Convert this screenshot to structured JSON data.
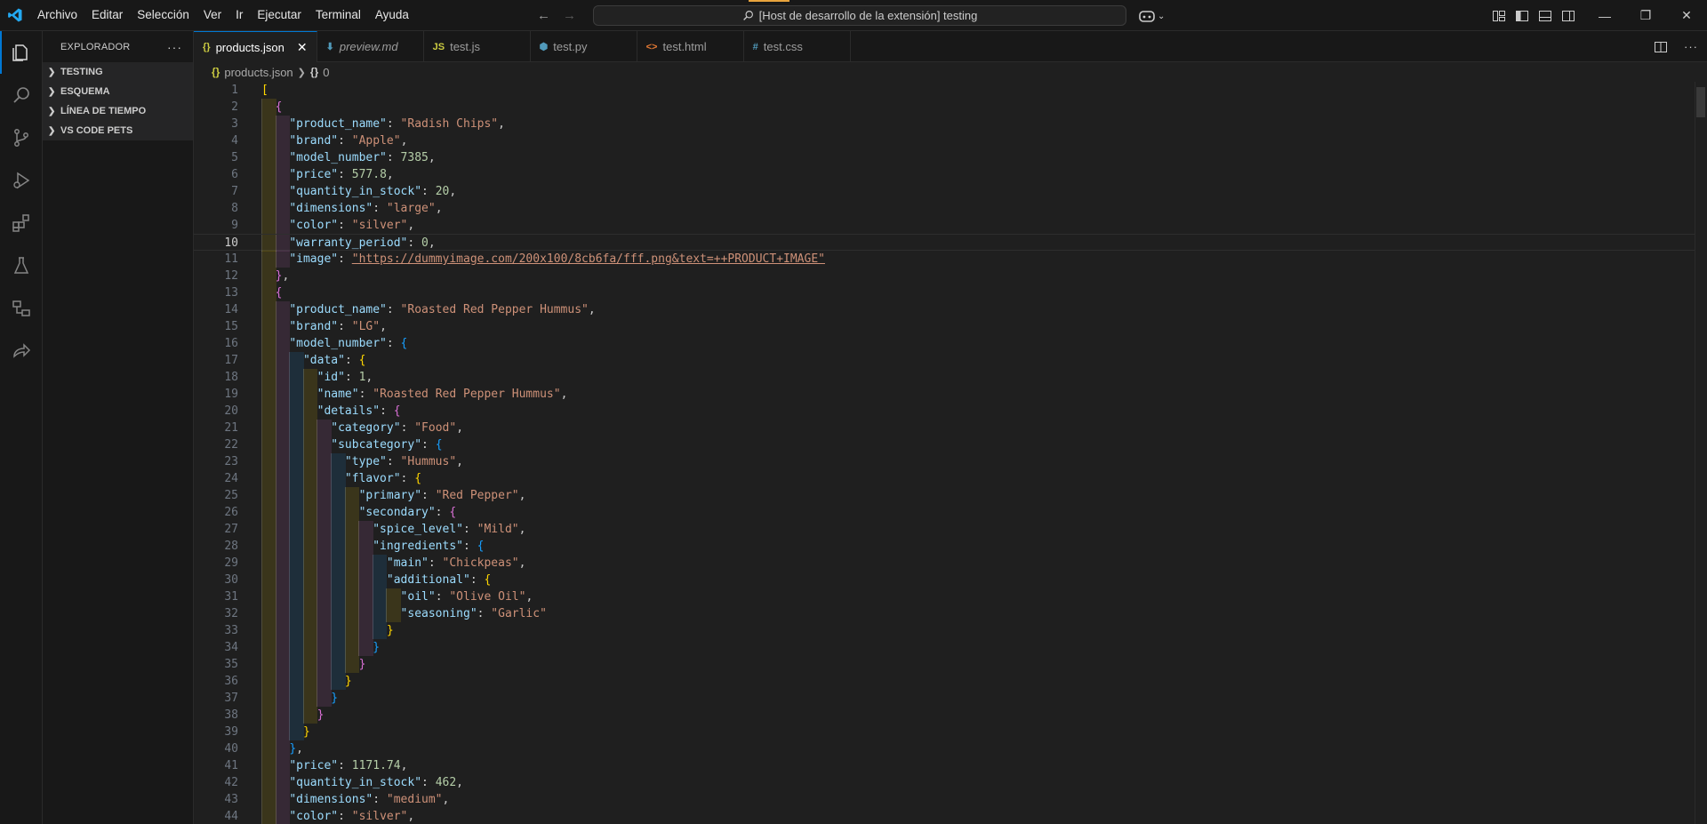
{
  "menu": [
    "Archivo",
    "Editar",
    "Selección",
    "Ver",
    "Ir",
    "Ejecutar",
    "Terminal",
    "Ayuda"
  ],
  "command_center": {
    "text": "[Host de desarrollo de la extensión] testing"
  },
  "sidebar": {
    "title": "EXPLORADOR",
    "sections": [
      "TESTING",
      "ESQUEMA",
      "LÍNEA DE TIEMPO",
      "VS CODE PETS"
    ]
  },
  "tabs": [
    {
      "label": "products.json",
      "icon": "{}",
      "icon_color": "#cbcb41",
      "active": true
    },
    {
      "label": "preview.md",
      "icon": "⬇",
      "icon_color": "#519aba",
      "italic": true
    },
    {
      "label": "test.js",
      "icon": "JS",
      "icon_color": "#cbcb41"
    },
    {
      "label": "test.py",
      "icon": "⬢",
      "icon_color": "#519aba"
    },
    {
      "label": "test.html",
      "icon": "<>",
      "icon_color": "#e37933"
    },
    {
      "label": "test.css",
      "icon": "#",
      "icon_color": "#519aba"
    }
  ],
  "breadcrumb": {
    "file": "products.json",
    "node": "0"
  },
  "editor": {
    "current_line": 10,
    "lines": [
      [
        [
          "[",
          "b1"
        ]
      ],
      [
        [
          "  ",
          ""
        ],
        [
          "{",
          "b2"
        ]
      ],
      [
        [
          "    ",
          ""
        ],
        [
          "\"product_name\"",
          "k"
        ],
        [
          ": ",
          "p"
        ],
        [
          "\"Radish Chips\"",
          "s"
        ],
        [
          ",",
          "p"
        ]
      ],
      [
        [
          "    ",
          ""
        ],
        [
          "\"brand\"",
          "k"
        ],
        [
          ": ",
          "p"
        ],
        [
          "\"Apple\"",
          "s"
        ],
        [
          ",",
          "p"
        ]
      ],
      [
        [
          "    ",
          ""
        ],
        [
          "\"model_number\"",
          "k"
        ],
        [
          ": ",
          "p"
        ],
        [
          "7385",
          "n"
        ],
        [
          ",",
          "p"
        ]
      ],
      [
        [
          "    ",
          ""
        ],
        [
          "\"price\"",
          "k"
        ],
        [
          ": ",
          "p"
        ],
        [
          "577.8",
          "n"
        ],
        [
          ",",
          "p"
        ]
      ],
      [
        [
          "    ",
          ""
        ],
        [
          "\"quantity_in_stock\"",
          "k"
        ],
        [
          ": ",
          "p"
        ],
        [
          "20",
          "n"
        ],
        [
          ",",
          "p"
        ]
      ],
      [
        [
          "    ",
          ""
        ],
        [
          "\"dimensions\"",
          "k"
        ],
        [
          ": ",
          "p"
        ],
        [
          "\"large\"",
          "s"
        ],
        [
          ",",
          "p"
        ]
      ],
      [
        [
          "    ",
          ""
        ],
        [
          "\"color\"",
          "k"
        ],
        [
          ": ",
          "p"
        ],
        [
          "\"silver\"",
          "s"
        ],
        [
          ",",
          "p"
        ]
      ],
      [
        [
          "    ",
          ""
        ],
        [
          "\"warranty_period\"",
          "k"
        ],
        [
          ": ",
          "p"
        ],
        [
          "0",
          "n"
        ],
        [
          ",",
          "p"
        ]
      ],
      [
        [
          "    ",
          ""
        ],
        [
          "\"image\"",
          "k"
        ],
        [
          ": ",
          "p"
        ],
        [
          "\"https://dummyimage.com/200x100/8cb6fa/fff.png&text=++PRODUCT+IMAGE\"",
          "s"
        ]
      ],
      [
        [
          "  ",
          ""
        ],
        [
          "}",
          "b2"
        ],
        [
          ",",
          "p"
        ]
      ],
      [
        [
          "  ",
          ""
        ],
        [
          "{",
          "b2"
        ]
      ],
      [
        [
          "    ",
          ""
        ],
        [
          "\"product_name\"",
          "k"
        ],
        [
          ": ",
          "p"
        ],
        [
          "\"Roasted Red Pepper Hummus\"",
          "s"
        ],
        [
          ",",
          "p"
        ]
      ],
      [
        [
          "    ",
          ""
        ],
        [
          "\"brand\"",
          "k"
        ],
        [
          ": ",
          "p"
        ],
        [
          "\"LG\"",
          "s"
        ],
        [
          ",",
          "p"
        ]
      ],
      [
        [
          "    ",
          ""
        ],
        [
          "\"model_number\"",
          "k"
        ],
        [
          ": ",
          "p"
        ],
        [
          "{",
          "b3"
        ]
      ],
      [
        [
          "      ",
          ""
        ],
        [
          "\"data\"",
          "k"
        ],
        [
          ": ",
          "p"
        ],
        [
          "{",
          "b1"
        ]
      ],
      [
        [
          "        ",
          ""
        ],
        [
          "\"id\"",
          "k"
        ],
        [
          ": ",
          "p"
        ],
        [
          "1",
          "n"
        ],
        [
          ",",
          "p"
        ]
      ],
      [
        [
          "        ",
          ""
        ],
        [
          "\"name\"",
          "k"
        ],
        [
          ": ",
          "p"
        ],
        [
          "\"Roasted Red Pepper Hummus\"",
          "s"
        ],
        [
          ",",
          "p"
        ]
      ],
      [
        [
          "        ",
          ""
        ],
        [
          "\"details\"",
          "k"
        ],
        [
          ": ",
          "p"
        ],
        [
          "{",
          "b2"
        ]
      ],
      [
        [
          "          ",
          ""
        ],
        [
          "\"category\"",
          "k"
        ],
        [
          ": ",
          "p"
        ],
        [
          "\"Food\"",
          "s"
        ],
        [
          ",",
          "p"
        ]
      ],
      [
        [
          "          ",
          ""
        ],
        [
          "\"subcategory\"",
          "k"
        ],
        [
          ": ",
          "p"
        ],
        [
          "{",
          "b3"
        ]
      ],
      [
        [
          "            ",
          ""
        ],
        [
          "\"type\"",
          "k"
        ],
        [
          ": ",
          "p"
        ],
        [
          "\"Hummus\"",
          "s"
        ],
        [
          ",",
          "p"
        ]
      ],
      [
        [
          "            ",
          ""
        ],
        [
          "\"flavor\"",
          "k"
        ],
        [
          ": ",
          "p"
        ],
        [
          "{",
          "b1"
        ]
      ],
      [
        [
          "              ",
          ""
        ],
        [
          "\"primary\"",
          "k"
        ],
        [
          ": ",
          "p"
        ],
        [
          "\"Red Pepper\"",
          "s"
        ],
        [
          ",",
          "p"
        ]
      ],
      [
        [
          "              ",
          ""
        ],
        [
          "\"secondary\"",
          "k"
        ],
        [
          ": ",
          "p"
        ],
        [
          "{",
          "b2"
        ]
      ],
      [
        [
          "                ",
          ""
        ],
        [
          "\"spice_level\"",
          "k"
        ],
        [
          ": ",
          "p"
        ],
        [
          "\"Mild\"",
          "s"
        ],
        [
          ",",
          "p"
        ]
      ],
      [
        [
          "                ",
          ""
        ],
        [
          "\"ingredients\"",
          "k"
        ],
        [
          ": ",
          "p"
        ],
        [
          "{",
          "b3"
        ]
      ],
      [
        [
          "                  ",
          ""
        ],
        [
          "\"main\"",
          "k"
        ],
        [
          ": ",
          "p"
        ],
        [
          "\"Chickpeas\"",
          "s"
        ],
        [
          ",",
          "p"
        ]
      ],
      [
        [
          "                  ",
          ""
        ],
        [
          "\"additional\"",
          "k"
        ],
        [
          ": ",
          "p"
        ],
        [
          "{",
          "b1"
        ]
      ],
      [
        [
          "                    ",
          ""
        ],
        [
          "\"oil\"",
          "k"
        ],
        [
          ": ",
          "p"
        ],
        [
          "\"Olive Oil\"",
          "s"
        ],
        [
          ",",
          "p"
        ]
      ],
      [
        [
          "                    ",
          ""
        ],
        [
          "\"seasoning\"",
          "k"
        ],
        [
          ": ",
          "p"
        ],
        [
          "\"Garlic\"",
          "s"
        ]
      ],
      [
        [
          "                  ",
          ""
        ],
        [
          "}",
          "b1"
        ]
      ],
      [
        [
          "                ",
          ""
        ],
        [
          "}",
          "b3"
        ]
      ],
      [
        [
          "              ",
          ""
        ],
        [
          "}",
          "b2"
        ]
      ],
      [
        [
          "            ",
          ""
        ],
        [
          "}",
          "b1"
        ]
      ],
      [
        [
          "          ",
          ""
        ],
        [
          "}",
          "b3"
        ]
      ],
      [
        [
          "        ",
          ""
        ],
        [
          "}",
          "b2"
        ]
      ],
      [
        [
          "      ",
          ""
        ],
        [
          "}",
          "b1"
        ]
      ],
      [
        [
          "    ",
          ""
        ],
        [
          "}",
          "b3"
        ],
        [
          ",",
          "p"
        ]
      ],
      [
        [
          "    ",
          ""
        ],
        [
          "\"price\"",
          "k"
        ],
        [
          ": ",
          "p"
        ],
        [
          "1171.74",
          "n"
        ],
        [
          ",",
          "p"
        ]
      ],
      [
        [
          "    ",
          ""
        ],
        [
          "\"quantity_in_stock\"",
          "k"
        ],
        [
          ": ",
          "p"
        ],
        [
          "462",
          "n"
        ],
        [
          ",",
          "p"
        ]
      ],
      [
        [
          "    ",
          ""
        ],
        [
          "\"dimensions\"",
          "k"
        ],
        [
          ": ",
          "p"
        ],
        [
          "\"medium\"",
          "s"
        ],
        [
          ",",
          "p"
        ]
      ],
      [
        [
          "    ",
          ""
        ],
        [
          "\"color\"",
          "k"
        ],
        [
          ": ",
          "p"
        ],
        [
          "\"silver\"",
          "s"
        ],
        [
          ",",
          "p"
        ]
      ]
    ]
  }
}
